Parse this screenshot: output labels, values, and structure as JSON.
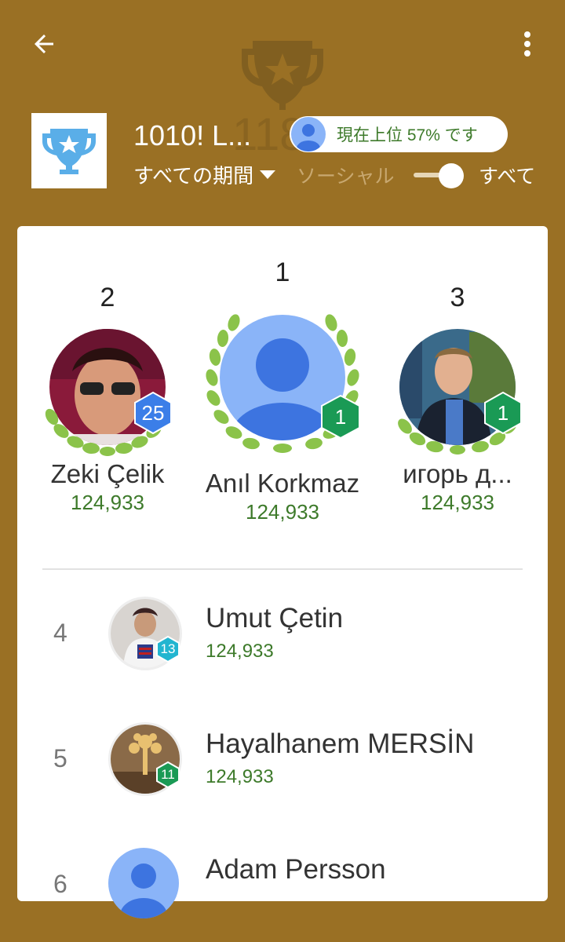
{
  "header": {
    "back_icon": "arrow-left-icon",
    "more_icon": "more-vert-icon",
    "bg_score": "118",
    "game_title": "1010! L...",
    "rank_pill": "現在上位 57% です",
    "period": "すべての期間",
    "social_label": "ソーシャル",
    "all_label": "すべて",
    "toggle_on": true
  },
  "podium": [
    {
      "rank": "2",
      "name": "Zeki Çelik",
      "score": "124,933",
      "level": "25",
      "badge_color": "#3b7ee8"
    },
    {
      "rank": "1",
      "name": "Anıl Korkmaz",
      "score": "124,933",
      "level": "1",
      "badge_color": "#1a9a55"
    },
    {
      "rank": "3",
      "name": "игорь д...",
      "score": "124,933",
      "level": "1",
      "badge_color": "#1a9a55"
    }
  ],
  "rows": [
    {
      "rank": "4",
      "name": "Umut Çetin",
      "score": "124,933",
      "level": "13",
      "badge_color": "#22b5d0"
    },
    {
      "rank": "5",
      "name": "Hayalhanem MERSİN",
      "score": "124,933",
      "level": "11",
      "badge_color": "#1a9a55"
    },
    {
      "rank": "6",
      "name": "Adam Persson",
      "score": "",
      "level": "",
      "badge_color": "#3b7ee8"
    }
  ],
  "colors": {
    "background": "#9a7024",
    "score_green": "#3d7a2a",
    "laurel_green": "#8bc34a"
  }
}
